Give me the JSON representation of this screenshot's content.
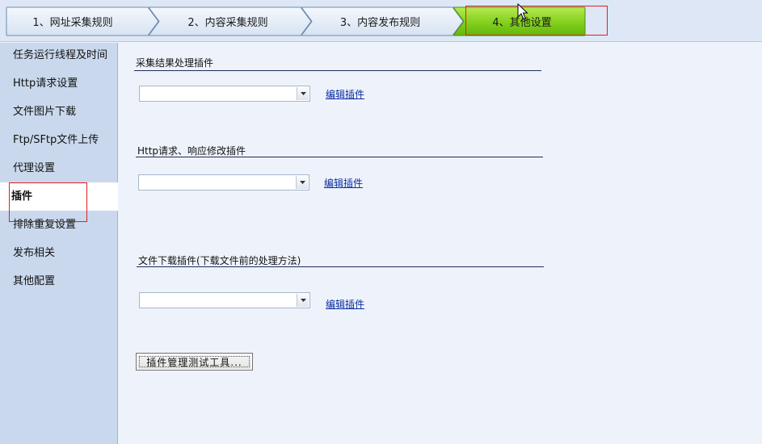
{
  "wizard": {
    "steps": [
      {
        "label": "1、网址采集规则",
        "active": false
      },
      {
        "label": "2、内容采集规则",
        "active": false
      },
      {
        "label": "3、内容发布规则",
        "active": false
      },
      {
        "label": "4、其他设置",
        "active": true
      }
    ],
    "colors": {
      "inactive": "#e6eef9",
      "active": "#7ccd1a",
      "border": "#6f8bb0"
    }
  },
  "sidebar": {
    "items": [
      {
        "label": "任务运行线程及时间"
      },
      {
        "label": "Http请求设置"
      },
      {
        "label": "文件图片下载"
      },
      {
        "label": "Ftp/SFtp文件上传"
      },
      {
        "label": "代理设置"
      },
      {
        "label": "插件",
        "active": true
      },
      {
        "label": "排除重复设置"
      },
      {
        "label": "发布相关"
      },
      {
        "label": "其他配置"
      }
    ]
  },
  "main": {
    "sections": [
      {
        "title": "采集结果处理插件",
        "selected": "",
        "link": "编辑插件"
      },
      {
        "title": "Http请求、响应修改插件",
        "selected": "",
        "link": "编辑插件"
      },
      {
        "title": "文件下载插件(下载文件前的处理方法)",
        "selected": "",
        "link": "编辑插件"
      }
    ],
    "test_button": "插件管理测试工具..."
  }
}
